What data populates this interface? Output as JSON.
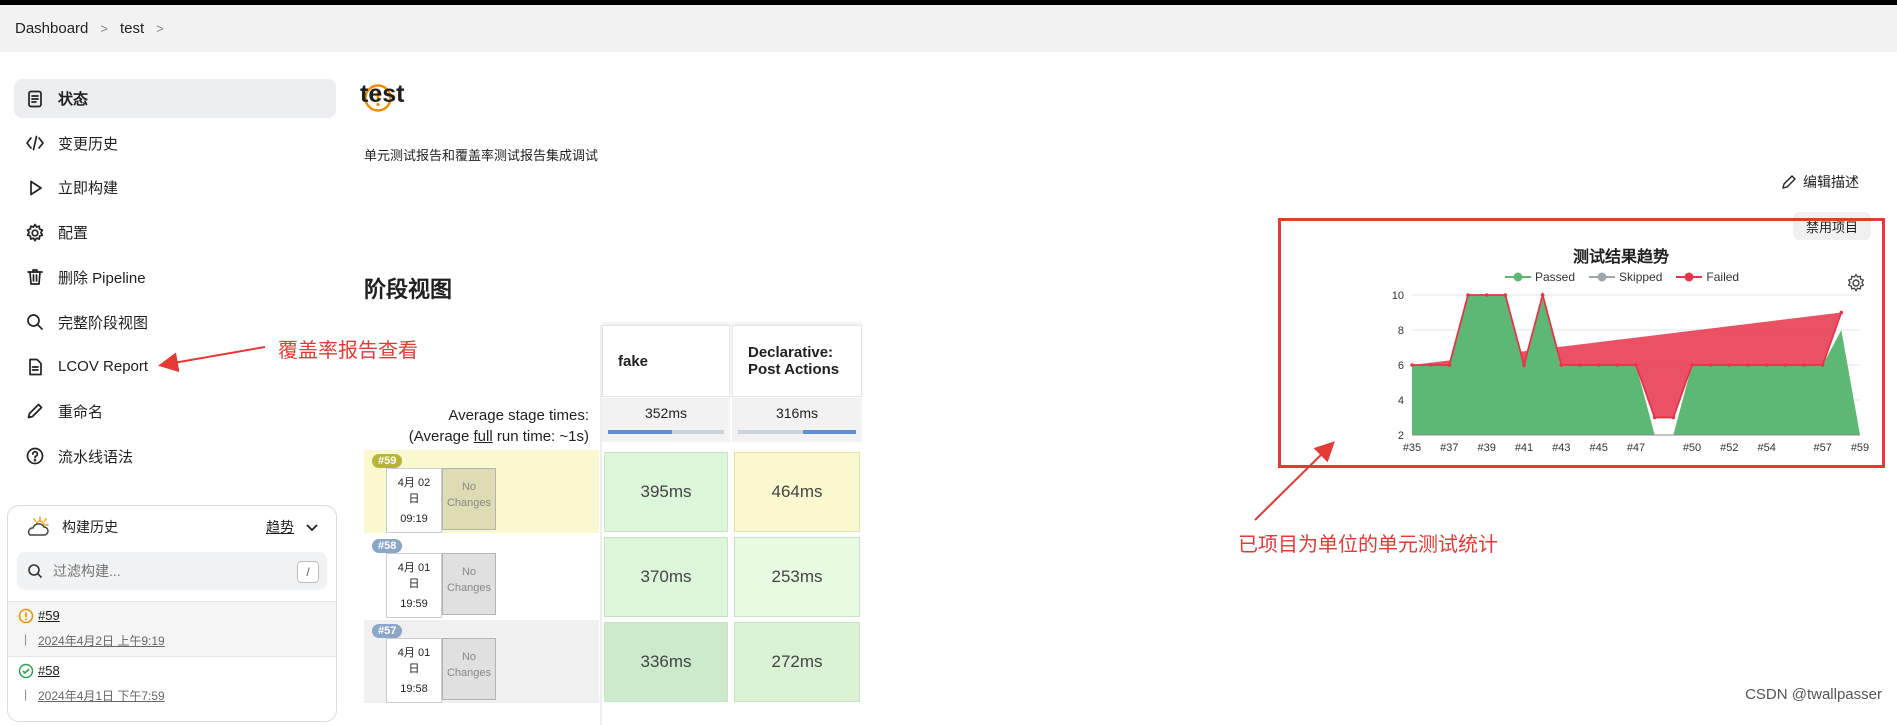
{
  "breadcrumb": [
    "Dashboard",
    "test"
  ],
  "sidebar": {
    "items": [
      {
        "label": "状态",
        "icon": "status-doc-icon",
        "active": true
      },
      {
        "label": "变更历史",
        "icon": "code-icon"
      },
      {
        "label": "立即构建",
        "icon": "play-icon"
      },
      {
        "label": "配置",
        "icon": "gear-icon"
      },
      {
        "label": "删除 Pipeline",
        "icon": "trash-icon"
      },
      {
        "label": "完整阶段视图",
        "icon": "search-icon"
      },
      {
        "label": "LCOV Report",
        "icon": "file-icon"
      },
      {
        "label": "重命名",
        "icon": "pencil-icon"
      },
      {
        "label": "流水线语法",
        "icon": "help-icon"
      }
    ]
  },
  "build_history": {
    "title": "构建历史",
    "trend_label": "趋势",
    "filter_placeholder": "过滤构建...",
    "shortcut": "/",
    "builds": [
      {
        "id": "#59",
        "date": "2024年4月2日 上午9:19",
        "status": "unstable"
      },
      {
        "id": "#58",
        "date": "2024年4月1日 下午7:59",
        "status": "success"
      }
    ]
  },
  "main": {
    "title": "test",
    "description": "单元测试报告和覆盖率测试报告集成调试",
    "edit_description": "编辑描述",
    "disable_project": "禁用项目",
    "stage_view_title": "阶段视图"
  },
  "stage_view": {
    "stages": [
      "fake",
      "Declarative: Post Actions"
    ],
    "avg_label_line1": "Average stage times:",
    "avg_label_line2_pre": "(Average ",
    "avg_label_line2_link": "full",
    "avg_label_line2_post": " run time: ~1s)",
    "avg_times": [
      "352ms",
      "316ms"
    ],
    "avg_fill": [
      0.55,
      0.45
    ],
    "no_changes": "No Changes",
    "runs": [
      {
        "badge": "#59",
        "date_line1": "4月 02",
        "date_line2": "日",
        "time": "09:19",
        "times": [
          "395ms",
          "464ms"
        ],
        "badge_color": "#b7b536"
      },
      {
        "badge": "#58",
        "date_line1": "4月 01",
        "date_line2": "日",
        "time": "19:59",
        "times": [
          "370ms",
          "253ms"
        ],
        "badge_color": "#8aa6c9"
      },
      {
        "badge": "#57",
        "date_line1": "4月 01",
        "date_line2": "日",
        "time": "19:58",
        "times": [
          "336ms",
          "272ms"
        ],
        "badge_color": "#8aa6c9"
      }
    ]
  },
  "chart_data": {
    "type": "area",
    "title": "测试结果趋势",
    "legend": [
      "Passed",
      "Skipped",
      "Failed"
    ],
    "legend_position": "top",
    "colors": {
      "Passed": "#5cb874",
      "Skipped": "#9ea5ad",
      "Failed": "#e8334a"
    },
    "x": [
      "#35",
      "#36",
      "#37",
      "#38",
      "#39",
      "#40",
      "#41",
      "#42",
      "#43",
      "#44",
      "#45",
      "#46",
      "#47",
      "#48",
      "#49",
      "#50",
      "#51",
      "#52",
      "#53",
      "#54",
      "#55",
      "#56",
      "#57",
      "#58",
      "#59"
    ],
    "x_tick_labels": [
      "#35",
      "#37",
      "#39",
      "#41",
      "#43",
      "#45",
      "#47",
      "#50",
      "#52",
      "#54",
      "#57",
      "#59"
    ],
    "series": [
      {
        "name": "Passed",
        "values": [
          6,
          6,
          6,
          10,
          10,
          10,
          6,
          10,
          6,
          6,
          6,
          6,
          6,
          2,
          2,
          6,
          6,
          6,
          6,
          6,
          6,
          6,
          6,
          8
        ]
      },
      {
        "name": "Failed",
        "values": [
          0,
          0,
          0,
          0,
          0,
          0,
          0,
          0,
          0,
          0,
          0,
          0,
          0,
          1,
          1,
          0,
          0,
          0,
          0,
          0,
          0,
          0,
          0,
          1
        ]
      }
    ],
    "y_ticks": [
      2,
      4,
      6,
      8,
      10
    ],
    "ylim": [
      2,
      10
    ],
    "grid": true
  },
  "annotations": {
    "coverage": "覆盖率报告查看",
    "unit_stats": "已项目为单位的单元测试统计"
  },
  "watermark": "CSDN @twallpasser"
}
